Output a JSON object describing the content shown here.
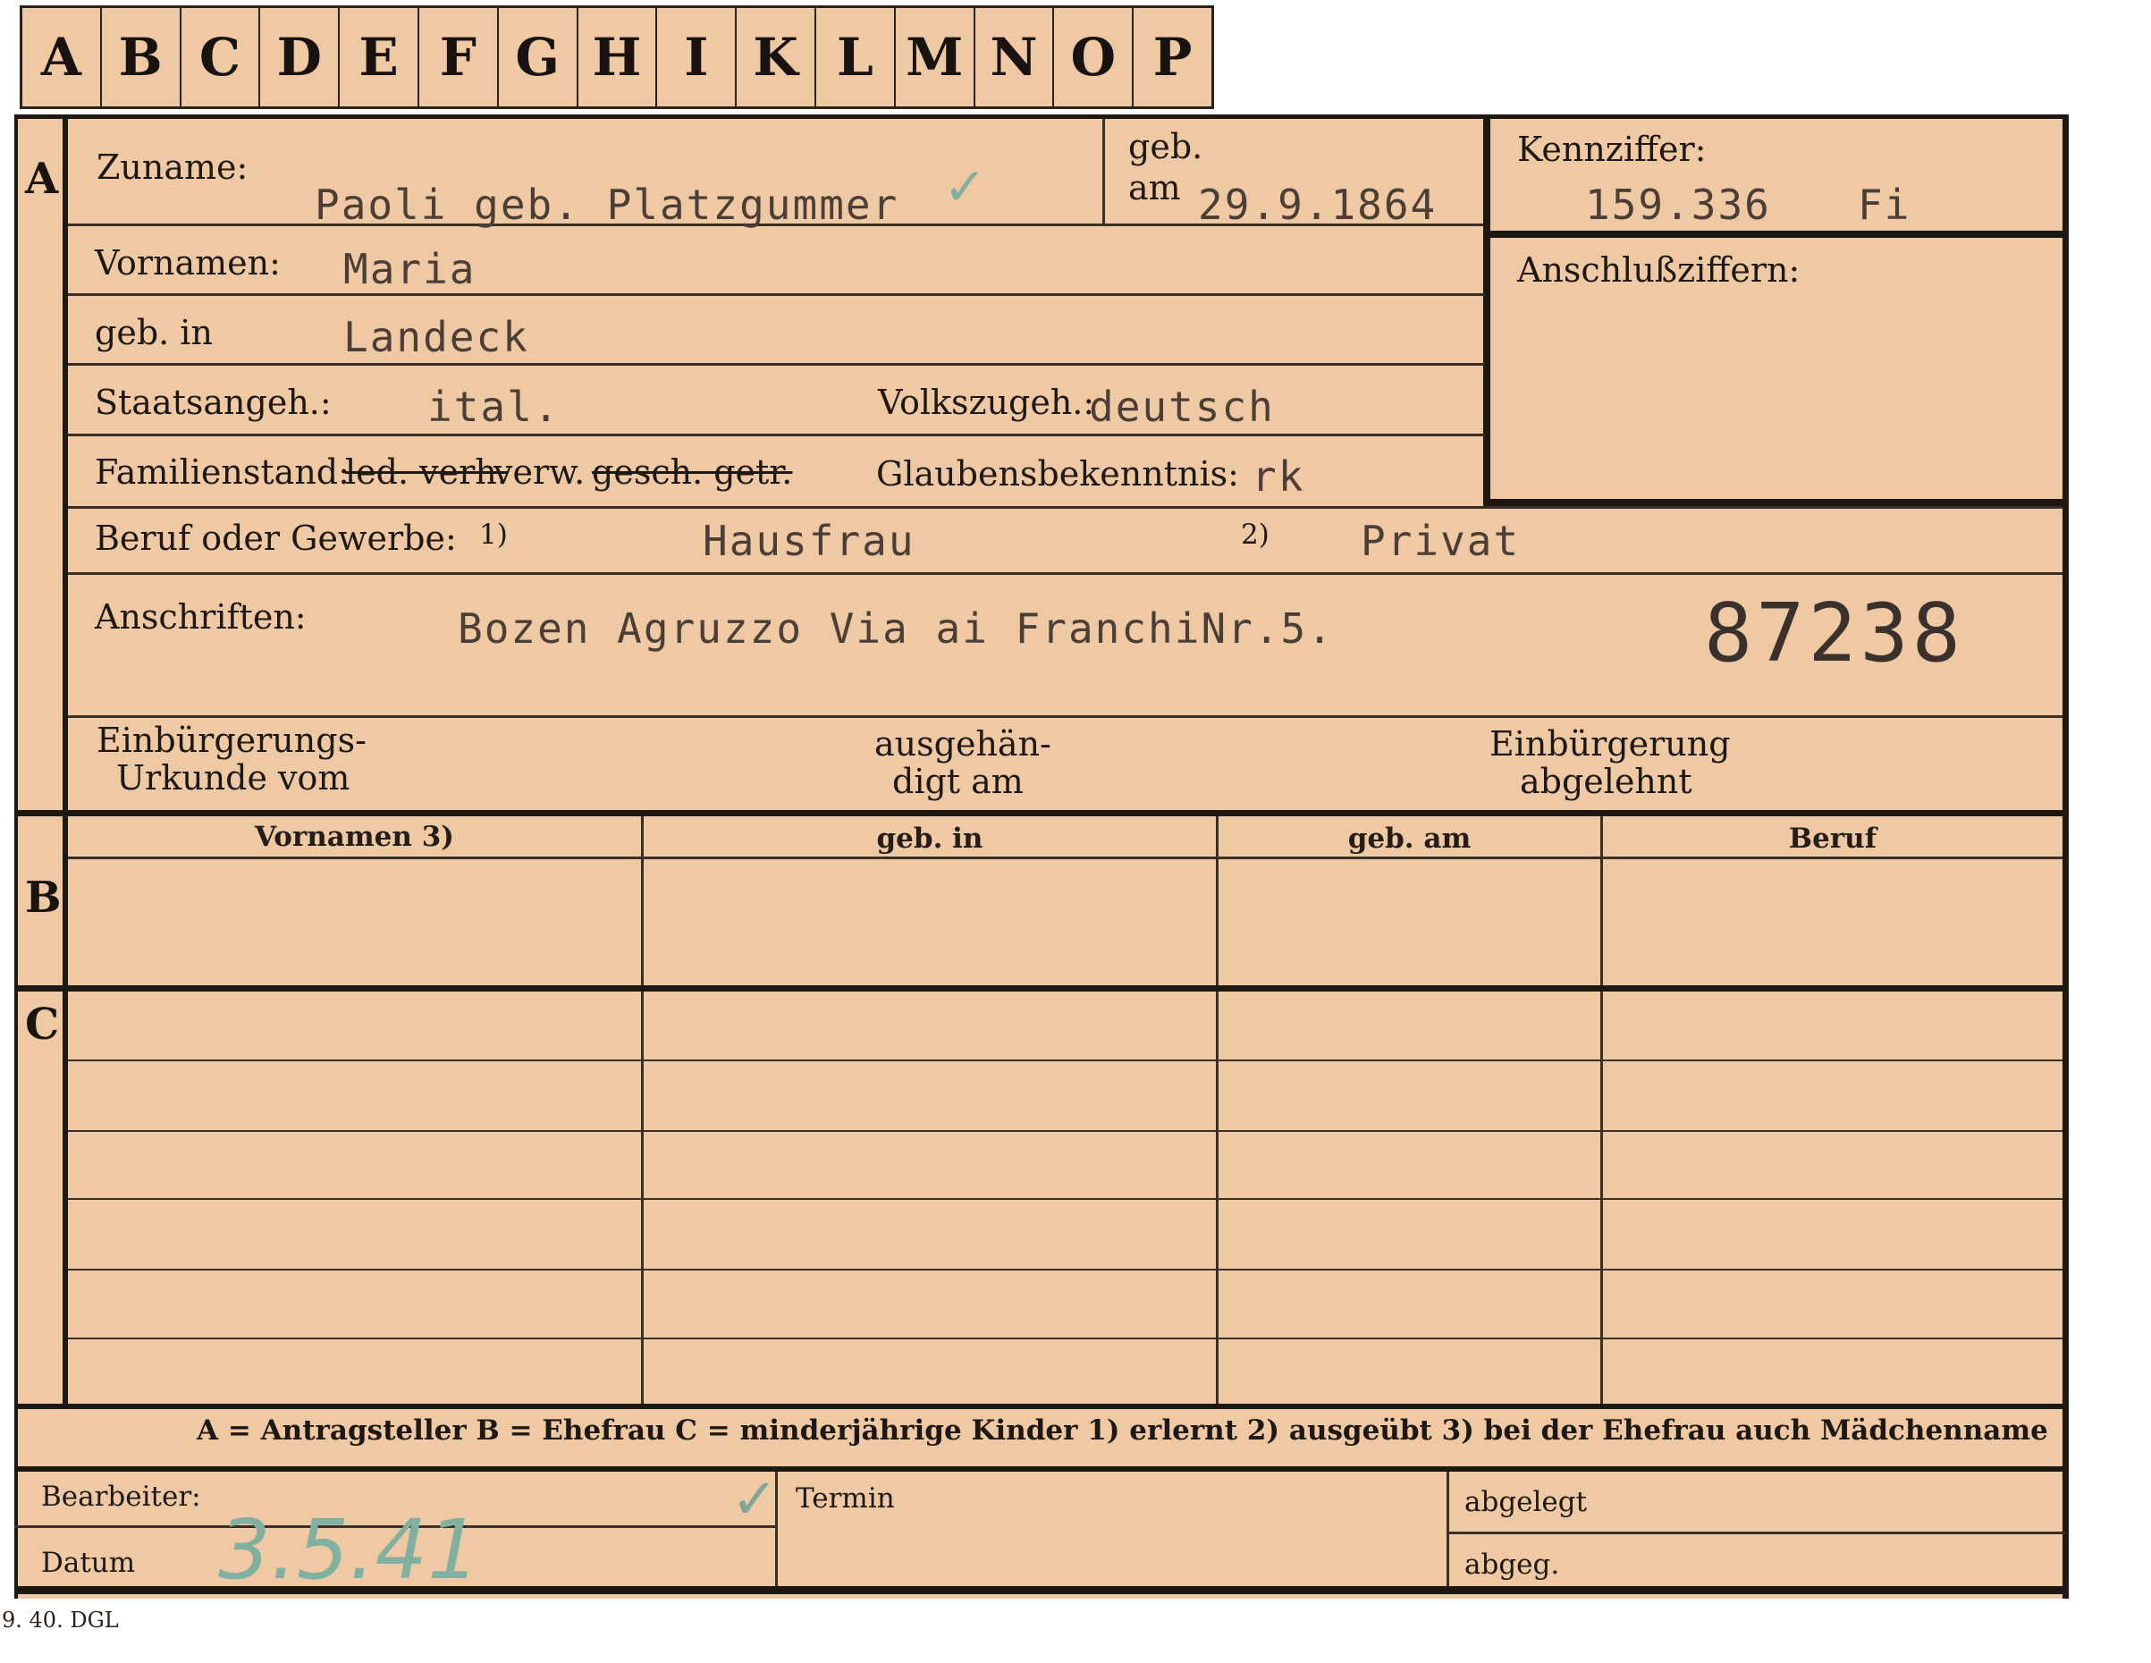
{
  "tabs": [
    "A",
    "B",
    "C",
    "D",
    "E",
    "F",
    "G",
    "H",
    "I",
    "K",
    "L",
    "M",
    "N",
    "O",
    "P"
  ],
  "section_a": {
    "marker": "A",
    "zuname_label": "Zuname:",
    "zuname_value": "Paoli geb. Platzgummer",
    "geb_label": "geb.",
    "am_label": "am",
    "geb_am_value": "29.9.1864",
    "kennziffer_label": "Kennziffer:",
    "kennziffer_value": "159.336",
    "kennziffer_suffix": "Fi",
    "anschluss_label": "Anschlußziffern:",
    "vornamen_label": "Vornamen:",
    "vornamen_value": "Maria",
    "gebin_label": "geb. in",
    "gebin_value": "Landeck",
    "staats_label": "Staatsangeh.:",
    "staats_value": "ital.",
    "volks_label": "Volkszugeh.:",
    "volks_value": "deutsch",
    "familien_label": "Familienstand:",
    "familien_opt1": "led. verh.",
    "familien_opt2": "verw.",
    "familien_opt3": "gesch. getr.",
    "glauben_label": "Glaubensbekenntnis:",
    "glauben_value": "rk",
    "beruf_label": "Beruf oder Gewerbe:",
    "beruf_note1": "1)",
    "beruf_value1": "Hausfrau",
    "beruf_note2": "2)",
    "beruf_value2": "Privat",
    "anschrift_label": "Anschriften:",
    "anschrift_value": "Bozen Agruzzo Via ai FranchiNr.5.",
    "stamp_number": "87238",
    "urkunde_label_1": "Einbürgerungs-",
    "urkunde_label_2": "Urkunde vom",
    "ausgehaendigt_1": "ausgehän-",
    "ausgehaendigt_2": "digt am",
    "abgelehnt_1": "Einbürgerung",
    "abgelehnt_2": "abgelehnt"
  },
  "section_b": {
    "marker": "B",
    "columns": [
      "Vornamen 3)",
      "geb. in",
      "geb. am",
      "Beruf"
    ]
  },
  "section_c": {
    "marker": "C"
  },
  "legend": "A = Antragsteller   B = Ehefrau   C = minderjährige Kinder   1) erlernt   2) ausgeübt   3) bei der Ehefrau auch Mädchenname",
  "footer": {
    "bearbeiter_label": "Bearbeiter:",
    "datum_label": "Datum",
    "datum_value": "3.5.41",
    "termin_label": "Termin",
    "abgelegt_label": "abgelegt",
    "abgeg_label": "abgeg."
  },
  "print_code": "9. 40. DGL"
}
